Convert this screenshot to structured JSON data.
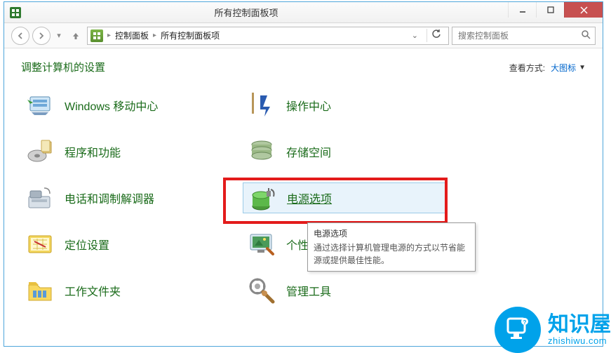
{
  "window": {
    "title": "所有控制面板项"
  },
  "nav": {
    "crumb1": "控制面板",
    "crumb2": "所有控制面板项",
    "search_placeholder": "搜索控制面板"
  },
  "heading": "调整计算机的设置",
  "viewby": {
    "label": "查看方式:",
    "value": "大图标"
  },
  "items": {
    "left": [
      "Windows 移动中心",
      "程序和功能",
      "电话和调制解调器",
      "定位设置",
      "工作文件夹"
    ],
    "right": [
      "操作中心",
      "存储空间",
      "电源选项",
      "个性化",
      "管理工具"
    ]
  },
  "tooltip": {
    "title": "电源选项",
    "body": "通过选择计算机管理电源的方式以节省能源或提供最佳性能。"
  },
  "watermark": {
    "cn": "知识屋",
    "en": "zhishiwu.com"
  }
}
